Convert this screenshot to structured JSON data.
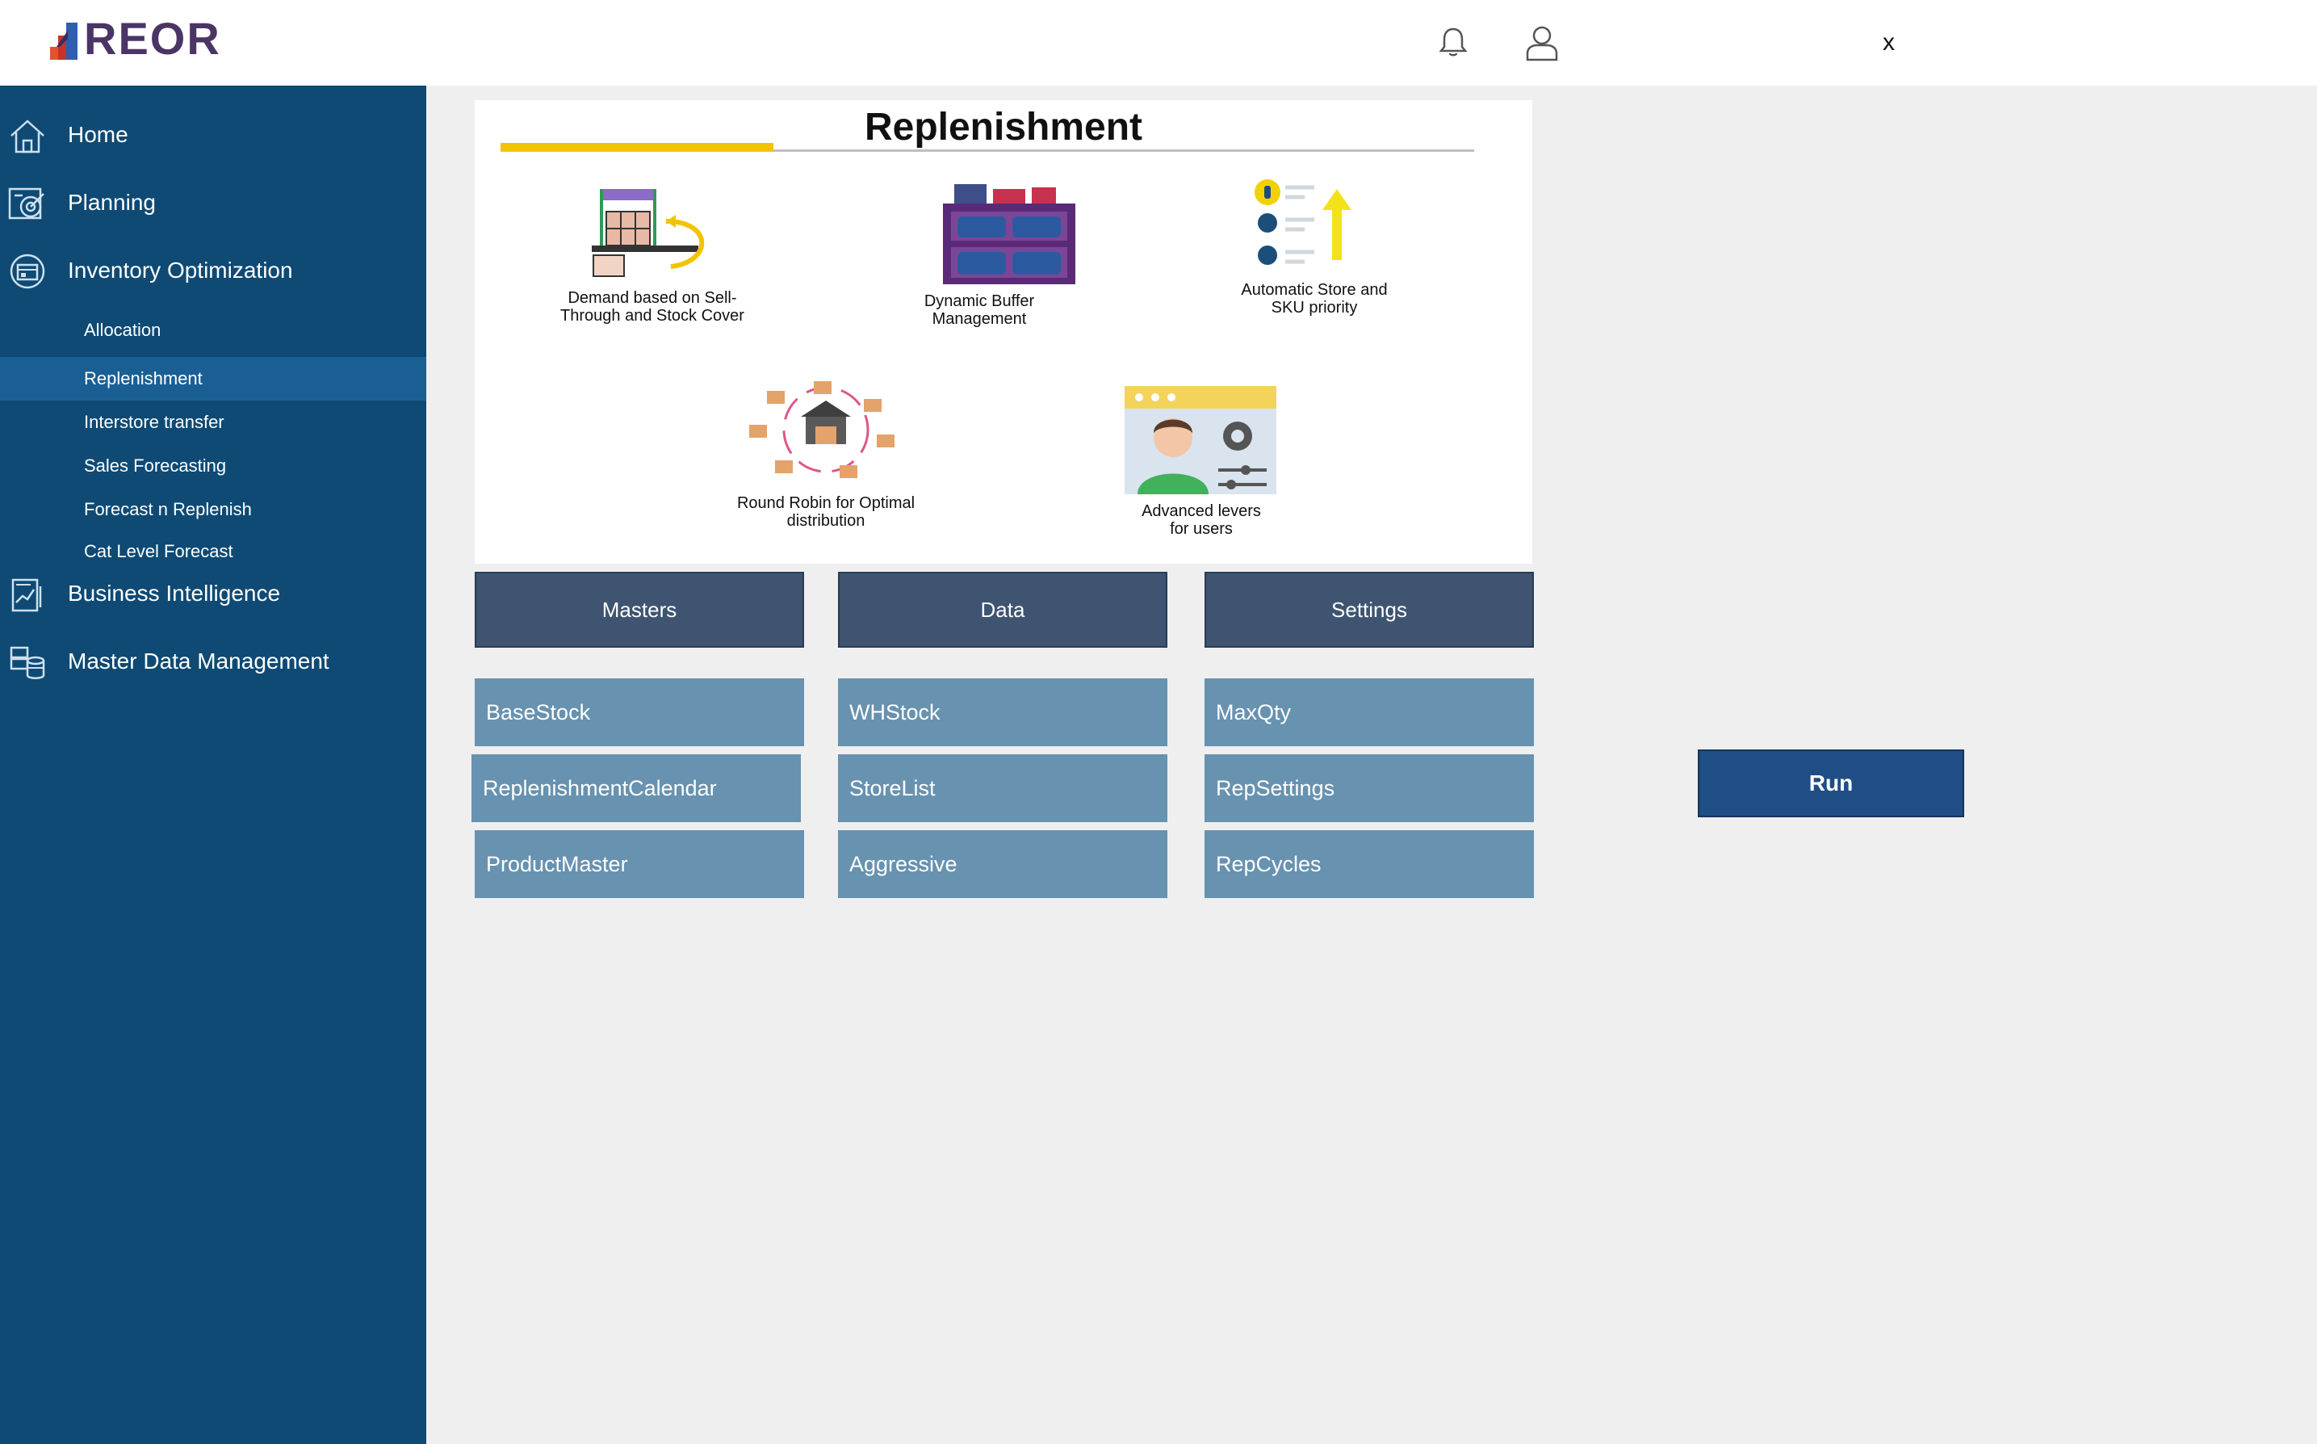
{
  "app": {
    "logo_text": "REOR"
  },
  "header": {
    "close_label": "x"
  },
  "sidebar": {
    "items": [
      {
        "label": "Home",
        "icon": "home-icon"
      },
      {
        "label": "Planning",
        "icon": "target-icon"
      },
      {
        "label": "Inventory Optimization",
        "icon": "inventory-icon"
      },
      {
        "label": "Business Intelligence",
        "icon": "report-icon"
      },
      {
        "label": "Master Data Management",
        "icon": "database-icon"
      }
    ],
    "sub_items": [
      {
        "label": "Allocation"
      },
      {
        "label": "Replenishment",
        "active": true
      },
      {
        "label": "Interstore transfer"
      },
      {
        "label": "Sales Forecasting"
      },
      {
        "label": "Forecast n Replenish"
      },
      {
        "label": "Cat Level Forecast"
      }
    ]
  },
  "banner": {
    "title": "Replenishment",
    "features": [
      {
        "text": "Demand based on Sell-Through and Stock Cover",
        "line1": "Demand based on Sell-",
        "line2": "Through and Stock Cover"
      },
      {
        "text": "Dynamic Buffer Management",
        "line1": "Dynamic Buffer",
        "line2": "Management"
      },
      {
        "text": "Automatic Store and SKU priority",
        "line1": "Automatic Store and",
        "line2": "SKU priority"
      },
      {
        "text": "Round Robin for Optimal distribution",
        "line1": "Round Robin for Optimal",
        "line2": "distribution"
      },
      {
        "text": "Advanced levers for users",
        "line1": "Advanced levers",
        "line2": "for users"
      }
    ]
  },
  "groups": {
    "masters": {
      "label": "Masters",
      "items": [
        "BaseStock",
        "ReplenishmentCalendar",
        "ProductMaster"
      ]
    },
    "data": {
      "label": "Data",
      "items": [
        "WHStock",
        "StoreList",
        "Aggressive"
      ]
    },
    "settings": {
      "label": "Settings",
      "items": [
        "MaxQty",
        "RepSettings",
        "RepCycles"
      ]
    }
  },
  "actions": {
    "run_label": "Run"
  },
  "colors": {
    "sidebar": "#0e4a74",
    "sidebar_active": "#1a5f94",
    "header_button": "#3e5470",
    "data_button": "#6792b0",
    "run_button": "#1f4e86",
    "accent_yellow": "#f5c200"
  }
}
